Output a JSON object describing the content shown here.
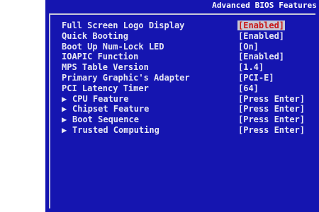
{
  "window": {
    "title": "Advanced BIOS Features"
  },
  "settings": [
    {
      "label": "Full Screen Logo Display",
      "value": "[Enabled]",
      "submenu": false,
      "selected": true
    },
    {
      "label": "Quick Booting",
      "value": "[Enabled]",
      "submenu": false,
      "selected": false
    },
    {
      "label": "Boot Up Num-Lock LED",
      "value": "[On]",
      "submenu": false,
      "selected": false
    },
    {
      "label": "IOAPIC Function",
      "value": "[Enabled]",
      "submenu": false,
      "selected": false
    },
    {
      "label": "MPS Table Version",
      "value": "[1.4]",
      "submenu": false,
      "selected": false
    },
    {
      "label": "Primary Graphic's Adapter",
      "value": "[PCI-E]",
      "submenu": false,
      "selected": false
    },
    {
      "label": "PCI Latency Timer",
      "value": "[64]",
      "submenu": false,
      "selected": false
    },
    {
      "label": "CPU Feature",
      "value": "[Press Enter]",
      "submenu": true,
      "selected": false
    },
    {
      "label": "Chipset Feature",
      "value": "[Press Enter]",
      "submenu": true,
      "selected": false
    },
    {
      "label": "Boot Sequence",
      "value": "[Press Enter]",
      "submenu": true,
      "selected": false
    },
    {
      "label": "Trusted Computing",
      "value": "[Press Enter]",
      "submenu": true,
      "selected": false
    }
  ],
  "icons": {
    "submenu_arrow": "▶"
  },
  "colors": {
    "background": "#1515b0",
    "text": "#e8e8f4",
    "selected_bg": "#c8c8d4",
    "selected_text": "#c81818"
  }
}
